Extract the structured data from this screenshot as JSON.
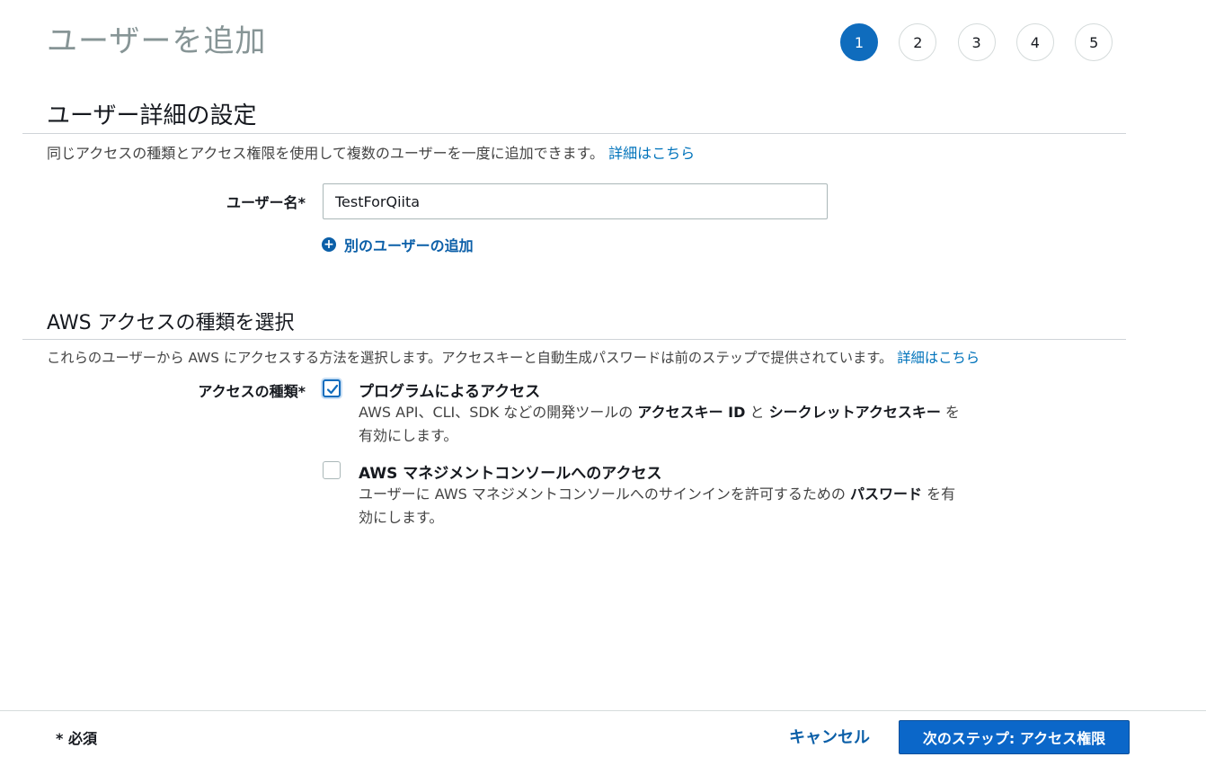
{
  "header": {
    "title": "ユーザーを追加",
    "steps": [
      "1",
      "2",
      "3",
      "4",
      "5"
    ],
    "active_step": "1"
  },
  "user_details": {
    "title": "ユーザー詳細の設定",
    "description": "同じアクセスの種類とアクセス権限を使用して複数のユーザーを一度に追加できます。",
    "learn_more": "詳細はこちら",
    "username_label": "ユーザー名*",
    "username_value": "TestForQiita",
    "add_another_user": "別のユーザーの追加"
  },
  "access_type": {
    "title": "AWS アクセスの種類を選択",
    "description": "これらのユーザーから AWS にアクセスする方法を選択します。アクセスキーと自動生成パスワードは前のステップで提供されています。",
    "learn_more": "詳細はこちら",
    "label": "アクセスの種類*",
    "options": [
      {
        "title": "プログラムによるアクセス",
        "checked": true,
        "desc_1": "AWS API、CLI、SDK などの開発ツールの",
        "desc_2": "アクセスキー ID",
        "desc_3": "と",
        "desc_4": "シークレットアクセスキー",
        "desc_5": "を有効にします。"
      },
      {
        "title": "AWS マネジメントコンソールへのアクセス",
        "checked": false,
        "desc_1": "ユーザーに AWS マネジメントコンソールへのサインインを許可するための",
        "desc_2": "パスワード",
        "desc_3": "を有効にします。"
      }
    ]
  },
  "footer": {
    "required_note": "* 必須",
    "cancel_label": "キャンセル",
    "next_label": "次のステップ: アクセス権限"
  },
  "colors": {
    "accent": "#0f6cbd",
    "link": "#0073bb",
    "title_gray": "#879596"
  }
}
